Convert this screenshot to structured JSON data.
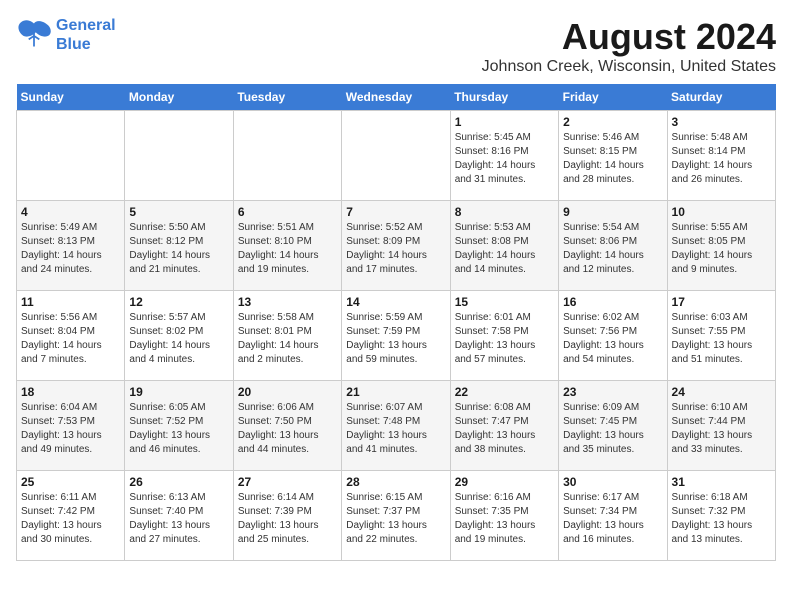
{
  "logo": {
    "line1": "General",
    "line2": "Blue"
  },
  "title": "August 2024",
  "location": "Johnson Creek, Wisconsin, United States",
  "days_of_week": [
    "Sunday",
    "Monday",
    "Tuesday",
    "Wednesday",
    "Thursday",
    "Friday",
    "Saturday"
  ],
  "weeks": [
    [
      {
        "day": "",
        "info": ""
      },
      {
        "day": "",
        "info": ""
      },
      {
        "day": "",
        "info": ""
      },
      {
        "day": "",
        "info": ""
      },
      {
        "day": "1",
        "info": "Sunrise: 5:45 AM\nSunset: 8:16 PM\nDaylight: 14 hours\nand 31 minutes."
      },
      {
        "day": "2",
        "info": "Sunrise: 5:46 AM\nSunset: 8:15 PM\nDaylight: 14 hours\nand 28 minutes."
      },
      {
        "day": "3",
        "info": "Sunrise: 5:48 AM\nSunset: 8:14 PM\nDaylight: 14 hours\nand 26 minutes."
      }
    ],
    [
      {
        "day": "4",
        "info": "Sunrise: 5:49 AM\nSunset: 8:13 PM\nDaylight: 14 hours\nand 24 minutes."
      },
      {
        "day": "5",
        "info": "Sunrise: 5:50 AM\nSunset: 8:12 PM\nDaylight: 14 hours\nand 21 minutes."
      },
      {
        "day": "6",
        "info": "Sunrise: 5:51 AM\nSunset: 8:10 PM\nDaylight: 14 hours\nand 19 minutes."
      },
      {
        "day": "7",
        "info": "Sunrise: 5:52 AM\nSunset: 8:09 PM\nDaylight: 14 hours\nand 17 minutes."
      },
      {
        "day": "8",
        "info": "Sunrise: 5:53 AM\nSunset: 8:08 PM\nDaylight: 14 hours\nand 14 minutes."
      },
      {
        "day": "9",
        "info": "Sunrise: 5:54 AM\nSunset: 8:06 PM\nDaylight: 14 hours\nand 12 minutes."
      },
      {
        "day": "10",
        "info": "Sunrise: 5:55 AM\nSunset: 8:05 PM\nDaylight: 14 hours\nand 9 minutes."
      }
    ],
    [
      {
        "day": "11",
        "info": "Sunrise: 5:56 AM\nSunset: 8:04 PM\nDaylight: 14 hours\nand 7 minutes."
      },
      {
        "day": "12",
        "info": "Sunrise: 5:57 AM\nSunset: 8:02 PM\nDaylight: 14 hours\nand 4 minutes."
      },
      {
        "day": "13",
        "info": "Sunrise: 5:58 AM\nSunset: 8:01 PM\nDaylight: 14 hours\nand 2 minutes."
      },
      {
        "day": "14",
        "info": "Sunrise: 5:59 AM\nSunset: 7:59 PM\nDaylight: 13 hours\nand 59 minutes."
      },
      {
        "day": "15",
        "info": "Sunrise: 6:01 AM\nSunset: 7:58 PM\nDaylight: 13 hours\nand 57 minutes."
      },
      {
        "day": "16",
        "info": "Sunrise: 6:02 AM\nSunset: 7:56 PM\nDaylight: 13 hours\nand 54 minutes."
      },
      {
        "day": "17",
        "info": "Sunrise: 6:03 AM\nSunset: 7:55 PM\nDaylight: 13 hours\nand 51 minutes."
      }
    ],
    [
      {
        "day": "18",
        "info": "Sunrise: 6:04 AM\nSunset: 7:53 PM\nDaylight: 13 hours\nand 49 minutes."
      },
      {
        "day": "19",
        "info": "Sunrise: 6:05 AM\nSunset: 7:52 PM\nDaylight: 13 hours\nand 46 minutes."
      },
      {
        "day": "20",
        "info": "Sunrise: 6:06 AM\nSunset: 7:50 PM\nDaylight: 13 hours\nand 44 minutes."
      },
      {
        "day": "21",
        "info": "Sunrise: 6:07 AM\nSunset: 7:48 PM\nDaylight: 13 hours\nand 41 minutes."
      },
      {
        "day": "22",
        "info": "Sunrise: 6:08 AM\nSunset: 7:47 PM\nDaylight: 13 hours\nand 38 minutes."
      },
      {
        "day": "23",
        "info": "Sunrise: 6:09 AM\nSunset: 7:45 PM\nDaylight: 13 hours\nand 35 minutes."
      },
      {
        "day": "24",
        "info": "Sunrise: 6:10 AM\nSunset: 7:44 PM\nDaylight: 13 hours\nand 33 minutes."
      }
    ],
    [
      {
        "day": "25",
        "info": "Sunrise: 6:11 AM\nSunset: 7:42 PM\nDaylight: 13 hours\nand 30 minutes."
      },
      {
        "day": "26",
        "info": "Sunrise: 6:13 AM\nSunset: 7:40 PM\nDaylight: 13 hours\nand 27 minutes."
      },
      {
        "day": "27",
        "info": "Sunrise: 6:14 AM\nSunset: 7:39 PM\nDaylight: 13 hours\nand 25 minutes."
      },
      {
        "day": "28",
        "info": "Sunrise: 6:15 AM\nSunset: 7:37 PM\nDaylight: 13 hours\nand 22 minutes."
      },
      {
        "day": "29",
        "info": "Sunrise: 6:16 AM\nSunset: 7:35 PM\nDaylight: 13 hours\nand 19 minutes."
      },
      {
        "day": "30",
        "info": "Sunrise: 6:17 AM\nSunset: 7:34 PM\nDaylight: 13 hours\nand 16 minutes."
      },
      {
        "day": "31",
        "info": "Sunrise: 6:18 AM\nSunset: 7:32 PM\nDaylight: 13 hours\nand 13 minutes."
      }
    ]
  ]
}
